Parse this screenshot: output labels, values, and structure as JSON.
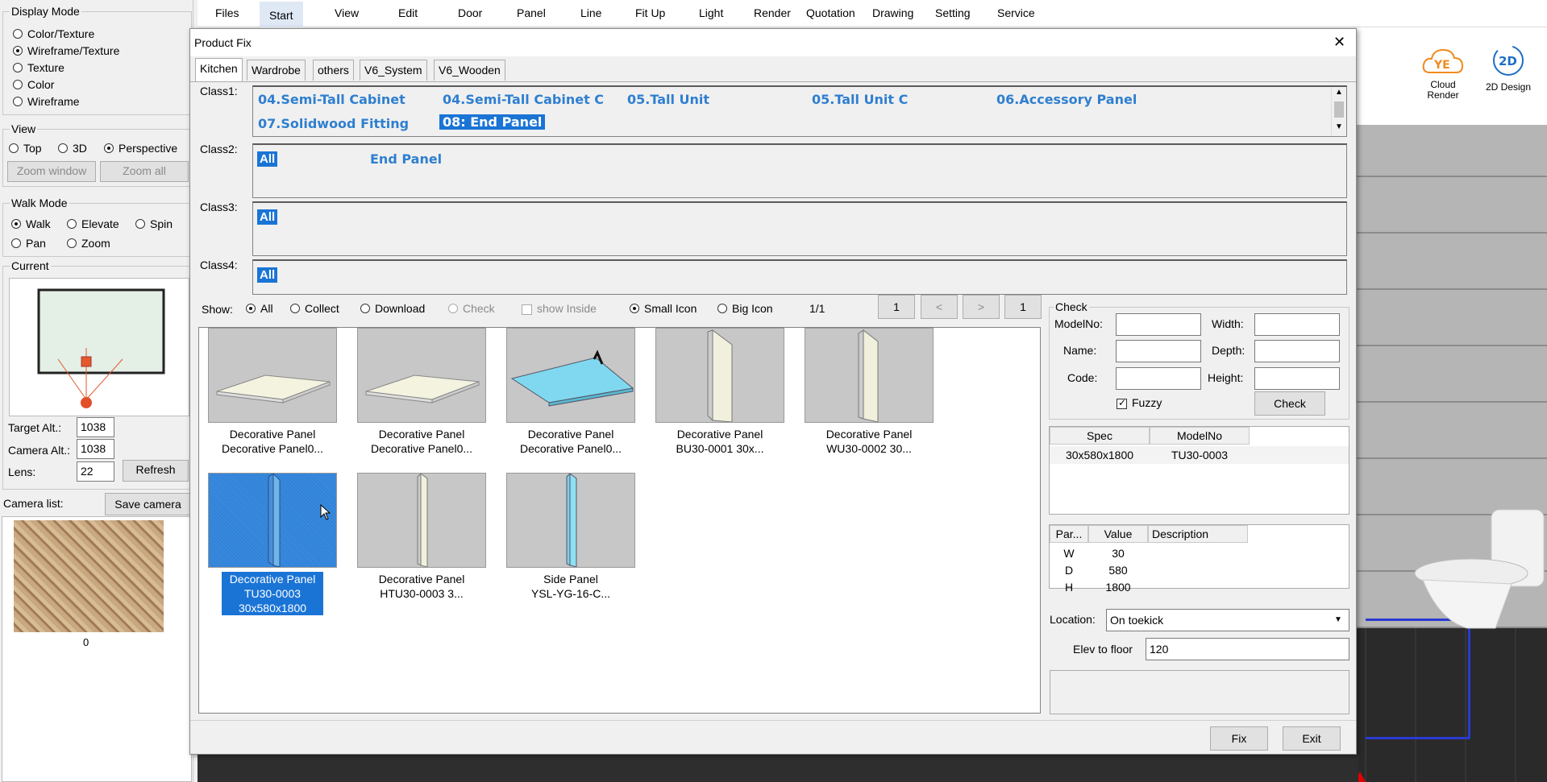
{
  "left": {
    "display_mode": {
      "title": "Display Mode",
      "options": [
        "Color/Texture",
        "Wireframe/Texture",
        "Texture",
        "Color",
        "Wireframe"
      ],
      "selected": 1
    },
    "view": {
      "title": "View",
      "options": [
        "Top",
        "3D",
        "Perspective"
      ],
      "selected": 2,
      "zoom_window": "Zoom window",
      "zoom_all": "Zoom all"
    },
    "walk_mode": {
      "title": "Walk Mode",
      "options": [
        "Walk",
        "Elevate",
        "Spin",
        "Pan",
        "Zoom"
      ],
      "selected": 0
    },
    "current": {
      "title": "Current",
      "target_alt_label": "Target Alt.:",
      "target_alt": "1038",
      "camera_alt_label": "Camera Alt.:",
      "camera_alt": "1038",
      "lens_label": "Lens:",
      "lens": "22",
      "refresh": "Refresh"
    },
    "camera_list": {
      "label": "Camera list:",
      "save": "Save camera",
      "thumb_caption": "0"
    }
  },
  "menu": [
    "Files",
    "Start",
    "View",
    "Edit",
    "Door",
    "Panel",
    "Line",
    "Fit Up",
    "Light",
    "Render",
    "Quotation",
    "Drawing",
    "Setting",
    "Service"
  ],
  "menu_active": "Start",
  "right": {
    "cloud_render_label": "Cloud\nRender",
    "cloud_render_l1": "Cloud",
    "cloud_render_l2": "Render",
    "design2d_label": "2D Design",
    "badge_2d": "2D",
    "cloud_logo": "YE"
  },
  "dialog": {
    "title": "Product Fix",
    "close": "✕",
    "tabs": [
      "Kitchen",
      "Wardrobe",
      "others",
      "V6_System",
      "V6_Wooden"
    ],
    "class1_label": "Class1:",
    "class1_items": [
      "04.Semi-Tall Cabinet",
      "04.Semi-Tall Cabinet C",
      "05.Tall Unit",
      "05.Tall Unit C",
      "06.Accessory Panel",
      "07.Solidwood Fitting",
      "08: End Panel"
    ],
    "class2_label": "Class2:",
    "class2_items": [
      "All",
      "End Panel"
    ],
    "class3_label": "Class3:",
    "class3_items": [
      "All"
    ],
    "class4_label": "Class4:",
    "class4_items": [
      "All"
    ],
    "show": {
      "label": "Show:",
      "all": "All",
      "collect": "Collect",
      "download": "Download",
      "check": "Check",
      "show_inside": "show Inside",
      "small_icon": "Small Icon",
      "big_icon": "Big Icon",
      "page": "1/1",
      "first": "1",
      "prev": "<",
      "next": ">",
      "last": "1"
    },
    "products": [
      {
        "l1": "Decorative Panel",
        "l2": "Decorative Panel0...",
        "l3": ""
      },
      {
        "l1": "Decorative Panel",
        "l2": "Decorative Panel0...",
        "l3": ""
      },
      {
        "l1": "Decorative Panel",
        "l2": "Decorative Panel0...",
        "l3": ""
      },
      {
        "l1": "Decorative Panel",
        "l2": "BU30-0001 30x...",
        "l3": ""
      },
      {
        "l1": "Decorative Panel",
        "l2": "WU30-0002 30...",
        "l3": ""
      },
      {
        "l1": "Decorative Panel",
        "l2": "TU30-0003",
        "l3": "30x580x1800"
      },
      {
        "l1": "Decorative Panel",
        "l2": "HTU30-0003 3...",
        "l3": ""
      },
      {
        "l1": "Side Panel",
        "l2": "YSL-YG-16-C...",
        "l3": ""
      }
    ],
    "check": {
      "title": "Check",
      "model_no": "ModelNo:",
      "width": "Width:",
      "name": "Name:",
      "depth": "Depth:",
      "code": "Code:",
      "height": "Height:",
      "fuzzy": "Fuzzy",
      "button": "Check"
    },
    "spec_table": {
      "headers": [
        "Spec",
        "ModelNo"
      ],
      "rows": [
        [
          "30x580x1800",
          "TU30-0003"
        ]
      ]
    },
    "param_table": {
      "headers": [
        "Par...",
        "Value",
        "Description"
      ],
      "rows": [
        [
          "W",
          "30",
          ""
        ],
        [
          "D",
          "580",
          ""
        ],
        [
          "H",
          "1800",
          ""
        ]
      ]
    },
    "location_label": "Location:",
    "location_value": "On toekick",
    "elev_label": "Elev to floor",
    "elev_value": "120",
    "fix": "Fix",
    "exit": "Exit"
  }
}
